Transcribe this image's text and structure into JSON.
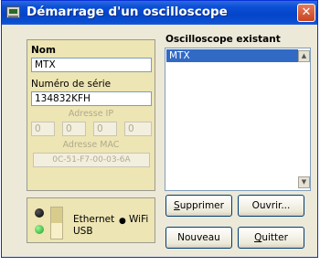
{
  "window": {
    "title": "Démarrage d'un oscilloscope",
    "close_glyph": "✕"
  },
  "left_panel": {
    "name_label": "Nom",
    "name_value": "MTX",
    "serial_label": "Numéro de série",
    "serial_value": "134832KFH",
    "ip_label": "Adresse IP",
    "ip_octets": [
      "0",
      "0",
      "0",
      "0"
    ],
    "mac_label": "Adresse MAC",
    "mac_value": "0C-51-F7-00-03-6A"
  },
  "existing_list": {
    "title": "Oscilloscope existant",
    "items": [
      "MTX"
    ]
  },
  "connection": {
    "ethernet_label": "Ethernet",
    "wifi_label": "WiFi",
    "usb_label": "USB",
    "radio_glyph": "●"
  },
  "buttons": {
    "delete": {
      "mnemonic": "S",
      "rest": "upprimer"
    },
    "open": {
      "label": "Ouvrir..."
    },
    "new": {
      "label": "Nouveau"
    },
    "quit": {
      "mnemonic": "Q",
      "rest": "uitter"
    }
  },
  "colors": {
    "title_bar": "#0a4fd6",
    "panel_bg": "#ede5b3",
    "selection": "#316ac5",
    "led_on": "#1aa11a",
    "led_off": "#000000"
  },
  "icons": {
    "app": "oscilloscope-app-icon",
    "close": "close-icon",
    "scroll_up": "scroll-up-icon",
    "scroll_down": "scroll-down-icon"
  }
}
